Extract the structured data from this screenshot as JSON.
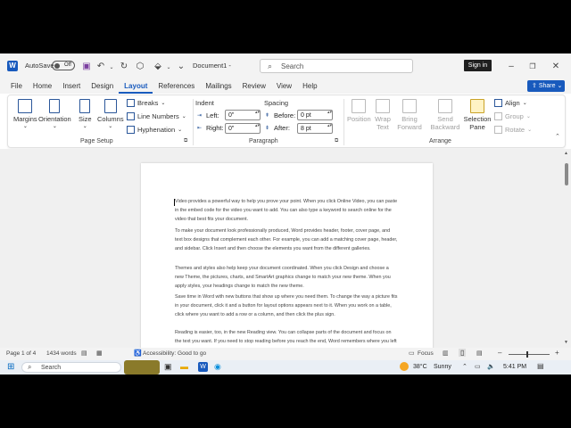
{
  "titlebar": {
    "autosave_label": "AutoSave",
    "autosave_state": "Off",
    "doc_title": "Document1  -",
    "search_placeholder": "Search",
    "signin_label": "Sign in",
    "share_label": "Share"
  },
  "menu": [
    "File",
    "Home",
    "Insert",
    "Design",
    "Layout",
    "References",
    "Mailings",
    "Review",
    "View",
    "Help"
  ],
  "active_menu": "Layout",
  "ribbon": {
    "page_setup": {
      "margins": "Margins",
      "orientation": "Orientation",
      "size": "Size",
      "columns": "Columns",
      "breaks": "Breaks",
      "line_numbers": "Line Numbers",
      "hyphenation": "Hyphenation",
      "group_label": "Page Setup"
    },
    "paragraph": {
      "indent_label": "Indent",
      "left_label": "Left:",
      "left_value": "0\"",
      "right_label": "Right:",
      "right_value": "0\"",
      "spacing_label": "Spacing",
      "before_label": "Before:",
      "before_value": "0 pt",
      "after_label": "After:",
      "after_value": "8 pt",
      "group_label": "Paragraph"
    },
    "arrange": {
      "position": "Position",
      "wrap_text": "Wrap Text",
      "bring_forward": "Bring Forward",
      "send_backward": "Send Backward",
      "selection_pane": "Selection Pane",
      "align": "Align",
      "group": "Group",
      "rotate": "Rotate",
      "group_label": "Arrange"
    }
  },
  "document": {
    "paragraphs": [
      "Video provides a powerful way to help you prove your point. When you click Online Video, you can paste in the embed code for the video you want to add. You can also type a keyword to search online for the video that best fits your document.",
      "To make your document look professionally produced, Word provides header, footer, cover page, and text box designs that complement each other. For example, you can add a matching cover page, header, and sidebar. Click Insert and then choose the elements you want from the different galleries.",
      "Themes and styles also help keep your document coordinated. When you click Design and choose a new Theme, the pictures, charts, and SmartArt graphics change to match your new theme. When you apply styles, your headings change to match the new theme.",
      "Save time in Word with new buttons that show up where you need them. To change the way a picture fits in your document, click it and a button for layout options appears next to it. When you work on a table, click where you want to add a row or a column, and then click the plus sign.",
      "Reading is easier, too, in the new Reading view. You can collapse parts of the document and focus on the text you want. If you need to stop reading before you reach the end, Word remembers where you left off - even on another device."
    ]
  },
  "statusbar": {
    "page": "Page 1 of 4",
    "words": "1434 words",
    "accessibility": "Accessibility: Good to go",
    "focus": "Focus"
  },
  "taskbar": {
    "search": "Search",
    "weather_temp": "38°C",
    "weather_text": "Sunny",
    "time": "5:41 PM"
  },
  "colors": {
    "accent": "#185abd",
    "word_blue": "#2b579a",
    "signin_bg": "#1f1f1f"
  }
}
